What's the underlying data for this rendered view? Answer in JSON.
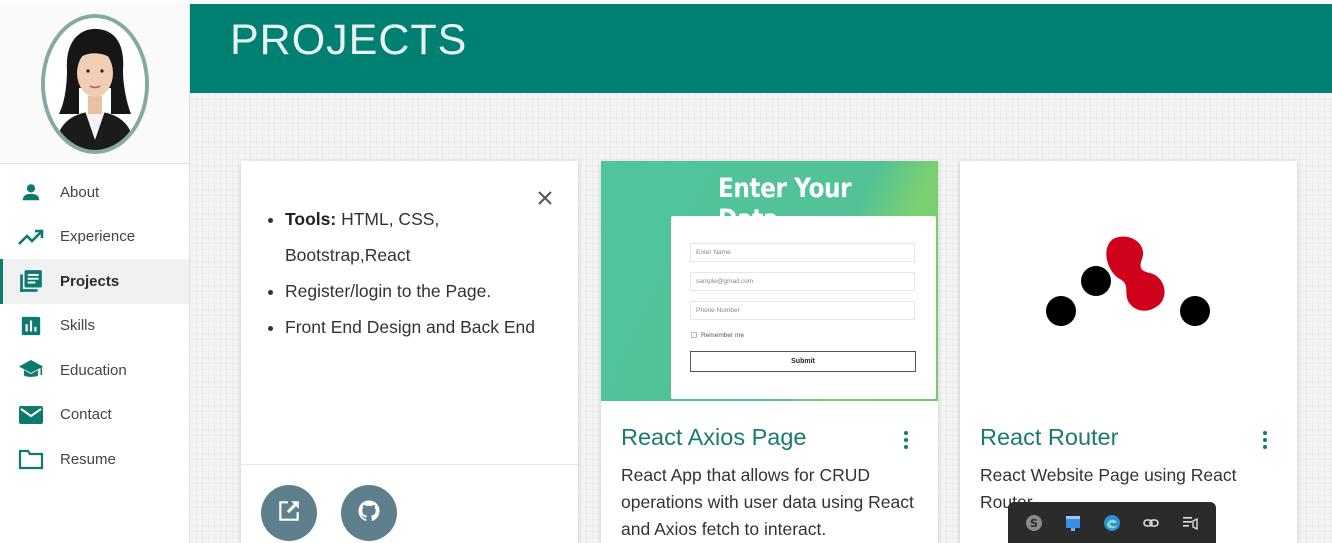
{
  "sidebar": {
    "items": [
      {
        "label": "About",
        "icon": "person-icon",
        "active": false
      },
      {
        "label": "Experience",
        "icon": "trending-up-icon",
        "active": false
      },
      {
        "label": "Projects",
        "icon": "library-books-icon",
        "active": true
      },
      {
        "label": "Skills",
        "icon": "bar-chart-icon",
        "active": false
      },
      {
        "label": "Education",
        "icon": "school-icon",
        "active": false
      },
      {
        "label": "Contact",
        "icon": "mail-icon",
        "active": false
      },
      {
        "label": "Resume",
        "icon": "folder-icon",
        "active": false
      }
    ]
  },
  "header": {
    "title": "PROJECTS"
  },
  "colors": {
    "accent": "#008072",
    "accent_text": "#1b7a70",
    "fab": "#5f7f8c"
  },
  "cards": [
    {
      "reveal": {
        "tools_label": "Tools:",
        "tools_value": " HTML, CSS, Bootstrap,React",
        "items": [
          "Register/login to the Page.",
          "Front End Design and Back End"
        ]
      }
    },
    {
      "title": "React Axios Page",
      "description": "React App that allows for CRUD operations with user data using React and Axios fetch to interact.",
      "screenshot": {
        "heading": "Enter Your Data",
        "fields": [
          "Enter Name",
          "sample@gmail.com",
          "Phone Number"
        ],
        "checkbox": "Remember me",
        "submit": "Submit"
      }
    },
    {
      "title": "React Router",
      "description": "React Website Page using React Router"
    }
  ],
  "tray": {
    "icons": [
      "skype-icon",
      "app-window-icon",
      "edge-icon",
      "link-icon",
      "notes-icon"
    ]
  }
}
